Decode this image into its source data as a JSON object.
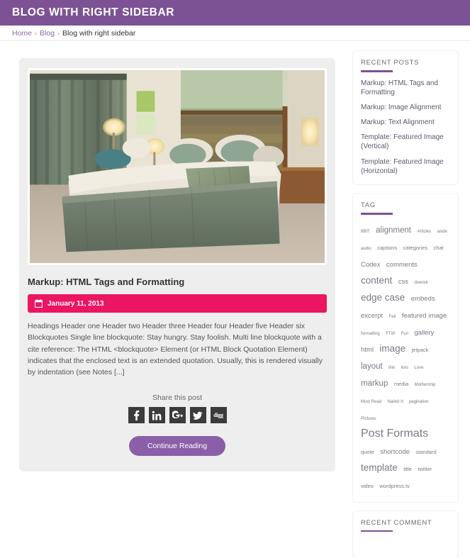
{
  "header": {
    "title": "Blog with right sidebar"
  },
  "breadcrumb": {
    "home": "Home",
    "blog": "Blog",
    "current": "Blog with right sidebar",
    "separator": "›"
  },
  "post": {
    "image_alt": "Hotel bedroom with king bed, green curtains and lamps",
    "title": "Markup: HTML Tags and Formatting",
    "date": "January 11, 2013",
    "date_icon": "calendar-icon",
    "excerpt": "Headings Header one Header two Header three Header four Header five Header six Blockquotes Single line blockquote: Stay hungry. Stay foolish. Multi line blockquote with a cite reference: The HTML <blockquote> Element (or HTML Block Quotation Element) indicates that the enclosed text is an extended quotation. Usually, this is rendered visually by indentation (see Notes [...]",
    "share_label": "Share this post",
    "share_buttons": [
      {
        "name": "facebook",
        "label": "f"
      },
      {
        "name": "linkedin",
        "label": "in"
      },
      {
        "name": "googleplus",
        "label": "G+"
      },
      {
        "name": "twitter",
        "label": "t"
      },
      {
        "name": "digg",
        "label": "digg"
      }
    ],
    "continue_label": "Continue Reading"
  },
  "sidebar": {
    "recent_posts": {
      "title": "Recent Posts",
      "items": [
        "Markup: HTML Tags and Formatting",
        "Markup: Image Alignment",
        "Markup: Text Alignment",
        "Template: Featured Image (Vertical)",
        "Template: Featured Image (Horizontal)"
      ]
    },
    "tag": {
      "title": "Tag",
      "tags": [
        {
          "label": "8BIT",
          "size": "xs"
        },
        {
          "label": "alignment",
          "size": "l"
        },
        {
          "label": "Articles",
          "size": "xs"
        },
        {
          "label": "aside",
          "size": "xs"
        },
        {
          "label": "audio",
          "size": "xs"
        },
        {
          "label": "captions",
          "size": "s"
        },
        {
          "label": "categories",
          "size": "s"
        },
        {
          "label": "chat",
          "size": "s"
        },
        {
          "label": "Codex",
          "size": "m"
        },
        {
          "label": "comments",
          "size": "m"
        },
        {
          "label": "content",
          "size": "xl"
        },
        {
          "label": "css",
          "size": "m"
        },
        {
          "label": "dowork",
          "size": "xs"
        },
        {
          "label": "edge case",
          "size": "xl"
        },
        {
          "label": "embeds",
          "size": "m"
        },
        {
          "label": "excerpt",
          "size": "m"
        },
        {
          "label": "Fail",
          "size": "xs"
        },
        {
          "label": "featured image",
          "size": "m"
        },
        {
          "label": "formatting",
          "size": "xs"
        },
        {
          "label": "FTW",
          "size": "xs"
        },
        {
          "label": "Fun",
          "size": "xs"
        },
        {
          "label": "gallery",
          "size": "m"
        },
        {
          "label": "html",
          "size": "m"
        },
        {
          "label": "image",
          "size": "xl"
        },
        {
          "label": "jetpack",
          "size": "s"
        },
        {
          "label": "layout",
          "size": "l"
        },
        {
          "label": "link",
          "size": "xs"
        },
        {
          "label": "lists",
          "size": "xs"
        },
        {
          "label": "Love",
          "size": "xs"
        },
        {
          "label": "markup",
          "size": "l"
        },
        {
          "label": "media",
          "size": "s"
        },
        {
          "label": "Mothership",
          "size": "xs"
        },
        {
          "label": "Must Read",
          "size": "xs"
        },
        {
          "label": "Nailed It",
          "size": "xs"
        },
        {
          "label": "pagination",
          "size": "xs"
        },
        {
          "label": "Pictures",
          "size": "xs"
        },
        {
          "label": "Post Formats",
          "size": "xxl"
        },
        {
          "label": "quote",
          "size": "s"
        },
        {
          "label": "shortcode",
          "size": "m"
        },
        {
          "label": "standard",
          "size": "s"
        },
        {
          "label": "template",
          "size": "xl"
        },
        {
          "label": "title",
          "size": "s"
        },
        {
          "label": "twitter",
          "size": "s"
        },
        {
          "label": "video",
          "size": "s"
        },
        {
          "label": "wordpress.tv",
          "size": "s"
        }
      ]
    },
    "recent_comment": {
      "title": "Recent Comment",
      "items": []
    }
  },
  "colors": {
    "header_purple": "#7c5295",
    "accent_purple": "#8a5fa8",
    "date_pink": "#ec1561",
    "card_gray": "#eeeeee",
    "social_dark": "#3b3b3b"
  }
}
